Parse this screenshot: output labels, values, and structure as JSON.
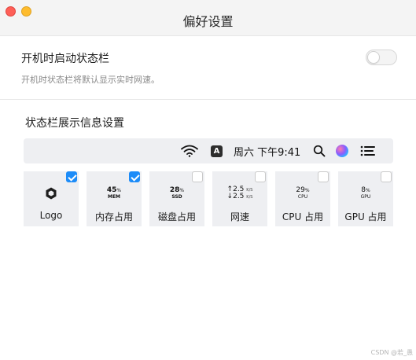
{
  "window": {
    "title": "偏好设置"
  },
  "startup": {
    "title": "开机时启动状态栏",
    "description": "开机时状态栏将默认显示实时网速。",
    "enabled": false
  },
  "display_section": {
    "title": "状态栏展示信息设置"
  },
  "menubar_preview": {
    "icons": [
      "wifi-icon",
      "input-source-icon",
      "search-icon",
      "siri-icon",
      "control-center-icon"
    ],
    "input_source_letter": "A",
    "clock": "周六 下午9:41"
  },
  "cards": [
    {
      "label": "Logo",
      "checked": true,
      "icon": "logo-icon"
    },
    {
      "label": "内存占用",
      "checked": true,
      "value": "45",
      "unit": "%",
      "sub": "MEM"
    },
    {
      "label": "磁盘占用",
      "checked": false,
      "value": "28",
      "unit": "%",
      "sub": "SSD"
    },
    {
      "label": "网速",
      "checked": false,
      "up_value": "2.5",
      "down_value": "2.5",
      "rate_unit": "K/S"
    },
    {
      "label": "CPU 占用",
      "checked": false,
      "value": "29",
      "unit": "%",
      "sub": "CPU"
    },
    {
      "label": "GPU 占用",
      "checked": false,
      "value": "8",
      "unit": "%",
      "sub": "GPU"
    }
  ],
  "colors": {
    "accent": "#1d8cf8",
    "card_bg": "#eeeff2",
    "close": "#fe5f57",
    "minimize": "#febc2e"
  },
  "watermark": "CSDN @若_愚"
}
